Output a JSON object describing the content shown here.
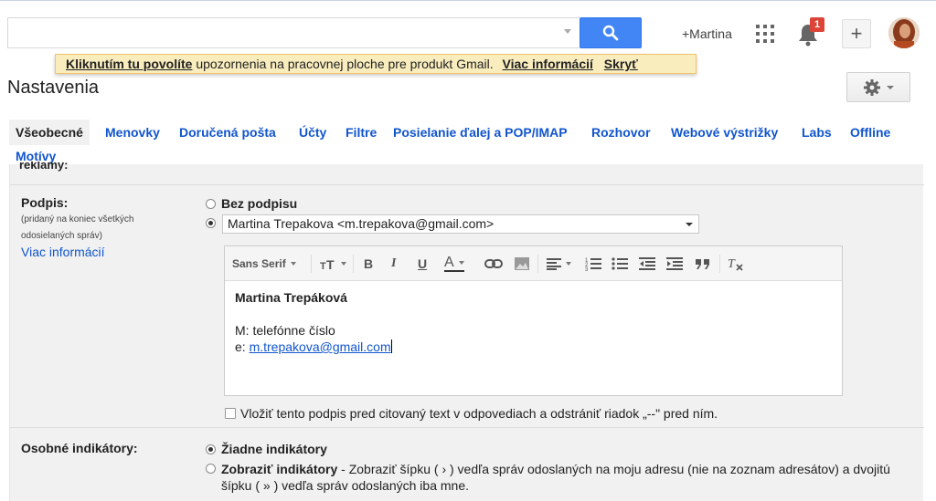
{
  "topbar": {
    "search_placeholder": "",
    "plus_name": "+Martina",
    "notification_count": "1",
    "plus_button": "+"
  },
  "notify": {
    "strong_text": "Kliknutím tu povolíte",
    "rest_text": " upozornenia na pracovnej ploche pre produkt Gmail.",
    "more_link": "Viac informácií",
    "hide_link": "Skryť"
  },
  "page": {
    "title": "Nastavenia"
  },
  "tabs": [
    {
      "label": "Všeobecné",
      "active": true
    },
    {
      "label": "Menovky"
    },
    {
      "label": "Doručená pošta"
    },
    {
      "label": "Účty"
    },
    {
      "label": "Filtre"
    },
    {
      "label": "Posielanie ďalej a POP/IMAP"
    },
    {
      "label": "Rozhovor"
    },
    {
      "label": "Webové výstrižky"
    },
    {
      "label": "Labs"
    },
    {
      "label": "Offline"
    },
    {
      "label": "Motívy"
    }
  ],
  "content": {
    "partial_label": "reklamy:"
  },
  "signature": {
    "label": "Podpis:",
    "note_line1": "(pridaný na koniec všetkých",
    "note_line2": "odosielaných správ)",
    "more_link": "Viac informácií",
    "option_none": "Bez podpisu",
    "selected_account": "Martina Trepakova <m.trepakova@gmail.com>",
    "toolbar": {
      "font": "Sans Serif",
      "bold": "B",
      "italic": "I",
      "underline": "U",
      "text_color": "A"
    },
    "body": {
      "name": "Martina Trepáková",
      "phone_line": "M:   telefónne číslo",
      "email_prefix": "e: ",
      "email": "m.trepakova@gmail.com"
    },
    "insert_before_quote": "Vložiť tento podpis pred citovaný text v odpovediach a odstrániť riadok „--\" pred ním."
  },
  "indicators": {
    "label": "Osobné indikátory:",
    "option_none": "Žiadne indikátory",
    "option_show_bold": "Zobraziť indikátory",
    "option_show_rest_line1": " - Zobraziť šípku ( › ) vedľa správ odoslaných na moju adresu (nie na zoznam adresátov) a dvojitú",
    "option_show_rest_line2": "šípku ( » ) vedľa správ odoslaných iba mne."
  }
}
